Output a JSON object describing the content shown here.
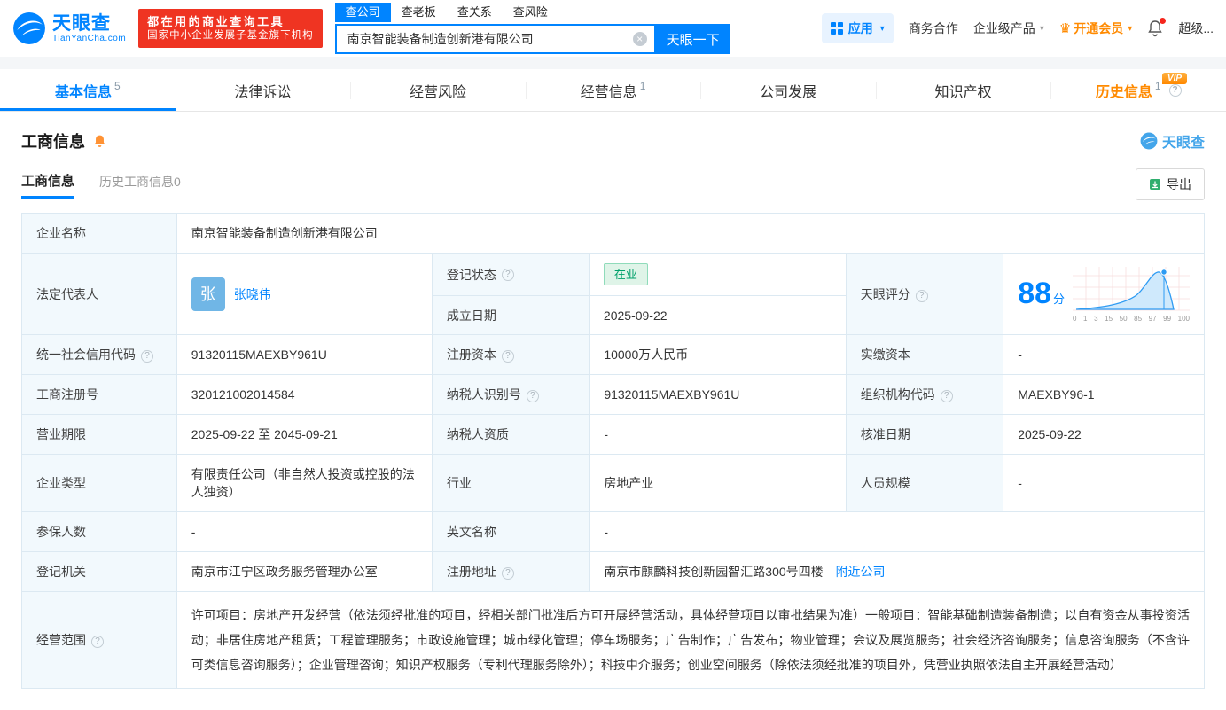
{
  "topbar": {
    "logo_title": "天眼查",
    "logo_subtitle": "TianYanCha.com",
    "slogan_line1": "都在用的商业查询工具",
    "slogan_line2": "国家中小企业发展子基金旗下机构",
    "mini_tabs": [
      {
        "label": "查公司",
        "active": true
      },
      {
        "label": "查老板",
        "active": false
      },
      {
        "label": "查关系",
        "active": false
      },
      {
        "label": "查风险",
        "active": false
      }
    ],
    "search_value": "南京智能装备制造创新港有限公司",
    "search_button": "天眼一下",
    "app_label": "应用",
    "biz_coop": "商务合作",
    "enterprise_products": "企业级产品",
    "open_vip": "开通会员",
    "super_label": "超级..."
  },
  "nav_tabs": [
    {
      "label": "基本信息",
      "badge": "5"
    },
    {
      "label": "法律诉讼",
      "badge": ""
    },
    {
      "label": "经营风险",
      "badge": ""
    },
    {
      "label": "经营信息",
      "badge": "1"
    },
    {
      "label": "公司发展",
      "badge": ""
    },
    {
      "label": "知识产权",
      "badge": ""
    },
    {
      "label": "历史信息",
      "badge": "1",
      "vip_tag": "VIP"
    }
  ],
  "section": {
    "title": "工商信息",
    "brand": "天眼查",
    "subtab_active": "工商信息",
    "subtab_history": "历史工商信息0",
    "export_label": "导出"
  },
  "fields": {
    "company_name": {
      "label": "企业名称",
      "value": "南京智能装备制造创新港有限公司"
    },
    "legal_rep": {
      "label": "法定代表人",
      "avatar": "张",
      "value": "张晓伟"
    },
    "reg_status": {
      "label": "登记状态",
      "value": "在业"
    },
    "establish_date": {
      "label": "成立日期",
      "value": "2025-09-22"
    },
    "score": {
      "label": "天眼评分",
      "value": "88",
      "unit": "分"
    },
    "credit_code": {
      "label": "统一社会信用代码",
      "value": "91320115MAEXBY961U"
    },
    "reg_capital": {
      "label": "注册资本",
      "value": "10000万人民币"
    },
    "paid_capital": {
      "label": "实缴资本",
      "value": "-"
    },
    "reg_no": {
      "label": "工商注册号",
      "value": "320121002014584"
    },
    "taxpayer_no": {
      "label": "纳税人识别号",
      "value": "91320115MAEXBY961U"
    },
    "org_code": {
      "label": "组织机构代码",
      "value": "MAEXBY96-1"
    },
    "term": {
      "label": "营业期限",
      "value": "2025-09-22 至 2045-09-21"
    },
    "taxpayer_quality": {
      "label": "纳税人资质",
      "value": "-"
    },
    "approve_date": {
      "label": "核准日期",
      "value": "2025-09-22"
    },
    "company_type": {
      "label": "企业类型",
      "value": "有限责任公司（非自然人投资或控股的法人独资）"
    },
    "industry": {
      "label": "行业",
      "value": "房地产业"
    },
    "staff_size": {
      "label": "人员规模",
      "value": "-"
    },
    "insured_num": {
      "label": "参保人数",
      "value": "-"
    },
    "english_name": {
      "label": "英文名称",
      "value": "-"
    },
    "reg_authority": {
      "label": "登记机关",
      "value": "南京市江宁区政务服务管理办公室"
    },
    "address": {
      "label": "注册地址",
      "value": "南京市麒麟科技创新园智汇路300号四楼",
      "link": "附近公司"
    },
    "scope": {
      "label": "经营范围",
      "value": "许可项目：房地产开发经营（依法须经批准的项目，经相关部门批准后方可开展经营活动，具体经营项目以审批结果为准）一般项目：智能基础制造装备制造；以自有资金从事投资活动；非居住房地产租赁；工程管理服务；市政设施管理；城市绿化管理；停车场服务；广告制作；广告发布；物业管理；会议及展览服务；社会经济咨询服务；信息咨询服务（不含许可类信息咨询服务）；企业管理咨询；知识产权服务（专利代理服务除外）；科技中介服务；创业空间服务（除依法须经批准的项目外，凭营业执照依法自主开展经营活动）"
    }
  },
  "score_chart": {
    "type": "area",
    "score": 88,
    "ticks": [
      "0",
      "1",
      "3",
      "15",
      "50",
      "85",
      "97",
      "99",
      "100"
    ]
  },
  "colors": {
    "primary": "#0084ff",
    "orange": "#ff8a00",
    "red": "#ef3422",
    "status_green": "#00a06a",
    "label_bg": "#f2f9fd",
    "table_border": "#dce9f2"
  }
}
